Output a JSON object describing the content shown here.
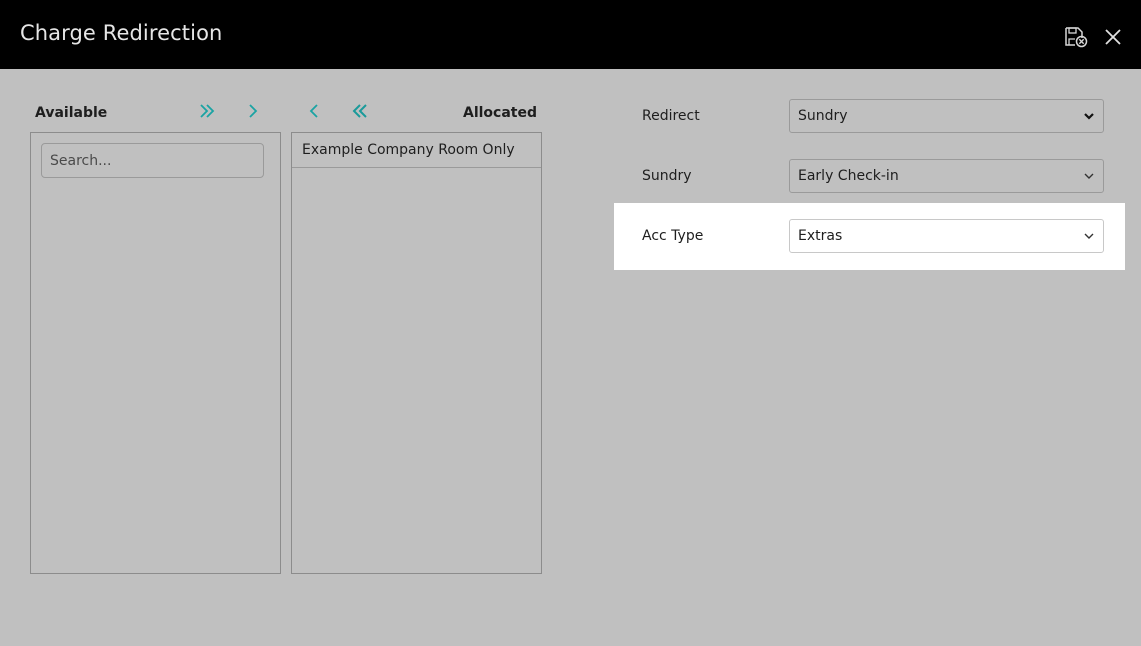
{
  "window": {
    "title": "Charge Redirection",
    "icons": {
      "save": "save-clear-icon",
      "close": "close-icon"
    }
  },
  "available": {
    "title": "Available",
    "search_placeholder": "Search...",
    "items": []
  },
  "allocated": {
    "title": "Allocated",
    "items": [
      "Example Company Room Only"
    ]
  },
  "controls": {
    "icons": [
      "double-chevron-right-icon",
      "chevron-right-icon",
      "chevron-left-icon",
      "double-chevron-left-icon"
    ]
  },
  "form": {
    "redirect": {
      "label": "Redirect",
      "value": "Sundry"
    },
    "sundry": {
      "label": "Sundry",
      "value": "Early Check-in"
    },
    "acc_type": {
      "label": "Acc Type",
      "value": "Extras"
    }
  },
  "colors": {
    "header_bg": "#000000",
    "body_bg": "#c0c0c0",
    "accent": "#1aa3a3",
    "highlight": "#ffffff"
  }
}
